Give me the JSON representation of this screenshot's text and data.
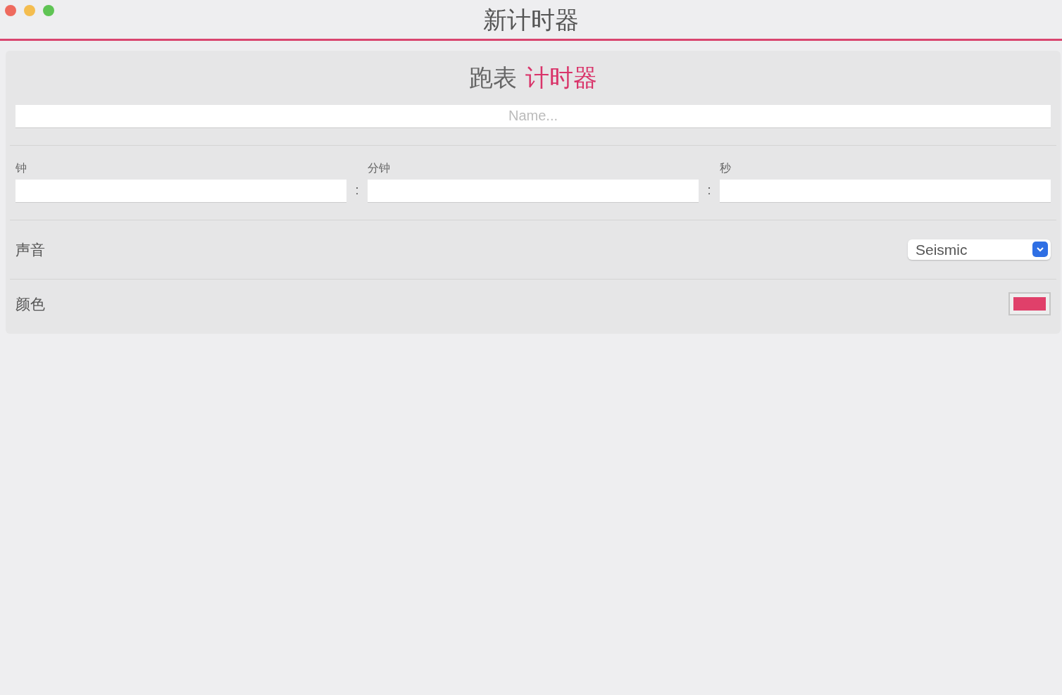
{
  "window": {
    "title": "新计时器"
  },
  "mode_options": [
    {
      "label": "跑表",
      "selected": false
    },
    {
      "label": "计时器",
      "selected": true
    }
  ],
  "name_field": {
    "placeholder": "Name..."
  },
  "time_fields": [
    {
      "label": "钟"
    },
    {
      "label": "分钟"
    },
    {
      "label": "秒"
    }
  ],
  "time_separator": ":",
  "sound": {
    "label": "声音",
    "value": "Seismic"
  },
  "color_setting": {
    "label": "颜色",
    "color": "#e0406a"
  }
}
